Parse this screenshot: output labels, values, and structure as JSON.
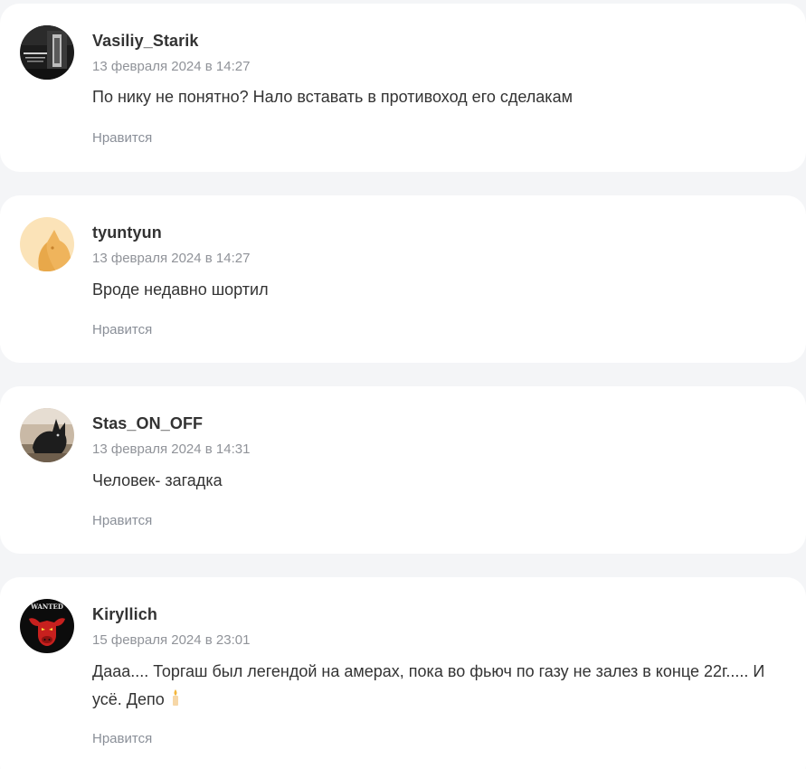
{
  "comments": [
    {
      "author": "Vasiliy_Starik",
      "date": "13 февраля 2024 в 14:27",
      "text": "По нику не понятно? Нало вставать в противоход его сделакам",
      "like_label": "Нравится",
      "avatar_icon": "photo-avatar-dark"
    },
    {
      "author": "tyuntyun",
      "date": "13 февраля 2024 в 14:27",
      "text": "Вроде недавно шортил",
      "like_label": "Нравится",
      "avatar_icon": "cat-avatar"
    },
    {
      "author": "Stas_ON_OFF",
      "date": "13 февраля 2024 в 14:31",
      "text": "Человек- загадка",
      "like_label": "Нравится",
      "avatar_icon": "photo-avatar-cat"
    },
    {
      "author": "Kiryllich",
      "date": "15 февраля 2024 в 23:01",
      "text": "Дааа.... Торгаш был легендой на амерах, пока во фьюч по газу не залез в конце 22г..... И усё. Депо",
      "like_label": "Нравится",
      "avatar_icon": "wanted-bull-avatar",
      "avatar_text": "WANTED"
    }
  ]
}
